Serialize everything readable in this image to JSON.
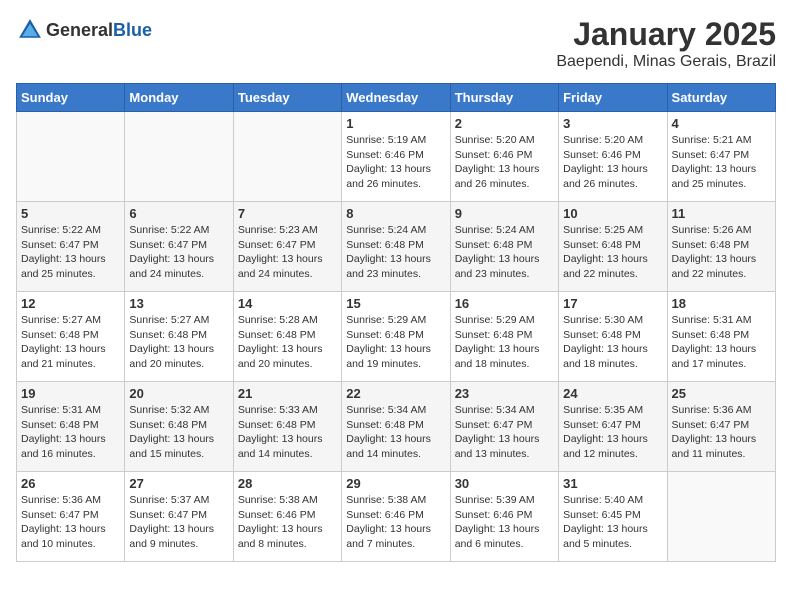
{
  "header": {
    "logo": {
      "general": "General",
      "blue": "Blue"
    },
    "title": "January 2025",
    "subtitle": "Baependi, Minas Gerais, Brazil"
  },
  "calendar": {
    "weekdays": [
      "Sunday",
      "Monday",
      "Tuesday",
      "Wednesday",
      "Thursday",
      "Friday",
      "Saturday"
    ],
    "rows": [
      [
        {
          "day": "",
          "sunrise": "",
          "sunset": "",
          "daylight": ""
        },
        {
          "day": "",
          "sunrise": "",
          "sunset": "",
          "daylight": ""
        },
        {
          "day": "",
          "sunrise": "",
          "sunset": "",
          "daylight": ""
        },
        {
          "day": "1",
          "sunrise": "Sunrise: 5:19 AM",
          "sunset": "Sunset: 6:46 PM",
          "daylight": "Daylight: 13 hours and 26 minutes."
        },
        {
          "day": "2",
          "sunrise": "Sunrise: 5:20 AM",
          "sunset": "Sunset: 6:46 PM",
          "daylight": "Daylight: 13 hours and 26 minutes."
        },
        {
          "day": "3",
          "sunrise": "Sunrise: 5:20 AM",
          "sunset": "Sunset: 6:46 PM",
          "daylight": "Daylight: 13 hours and 26 minutes."
        },
        {
          "day": "4",
          "sunrise": "Sunrise: 5:21 AM",
          "sunset": "Sunset: 6:47 PM",
          "daylight": "Daylight: 13 hours and 25 minutes."
        }
      ],
      [
        {
          "day": "5",
          "sunrise": "Sunrise: 5:22 AM",
          "sunset": "Sunset: 6:47 PM",
          "daylight": "Daylight: 13 hours and 25 minutes."
        },
        {
          "day": "6",
          "sunrise": "Sunrise: 5:22 AM",
          "sunset": "Sunset: 6:47 PM",
          "daylight": "Daylight: 13 hours and 24 minutes."
        },
        {
          "day": "7",
          "sunrise": "Sunrise: 5:23 AM",
          "sunset": "Sunset: 6:47 PM",
          "daylight": "Daylight: 13 hours and 24 minutes."
        },
        {
          "day": "8",
          "sunrise": "Sunrise: 5:24 AM",
          "sunset": "Sunset: 6:48 PM",
          "daylight": "Daylight: 13 hours and 23 minutes."
        },
        {
          "day": "9",
          "sunrise": "Sunrise: 5:24 AM",
          "sunset": "Sunset: 6:48 PM",
          "daylight": "Daylight: 13 hours and 23 minutes."
        },
        {
          "day": "10",
          "sunrise": "Sunrise: 5:25 AM",
          "sunset": "Sunset: 6:48 PM",
          "daylight": "Daylight: 13 hours and 22 minutes."
        },
        {
          "day": "11",
          "sunrise": "Sunrise: 5:26 AM",
          "sunset": "Sunset: 6:48 PM",
          "daylight": "Daylight: 13 hours and 22 minutes."
        }
      ],
      [
        {
          "day": "12",
          "sunrise": "Sunrise: 5:27 AM",
          "sunset": "Sunset: 6:48 PM",
          "daylight": "Daylight: 13 hours and 21 minutes."
        },
        {
          "day": "13",
          "sunrise": "Sunrise: 5:27 AM",
          "sunset": "Sunset: 6:48 PM",
          "daylight": "Daylight: 13 hours and 20 minutes."
        },
        {
          "day": "14",
          "sunrise": "Sunrise: 5:28 AM",
          "sunset": "Sunset: 6:48 PM",
          "daylight": "Daylight: 13 hours and 20 minutes."
        },
        {
          "day": "15",
          "sunrise": "Sunrise: 5:29 AM",
          "sunset": "Sunset: 6:48 PM",
          "daylight": "Daylight: 13 hours and 19 minutes."
        },
        {
          "day": "16",
          "sunrise": "Sunrise: 5:29 AM",
          "sunset": "Sunset: 6:48 PM",
          "daylight": "Daylight: 13 hours and 18 minutes."
        },
        {
          "day": "17",
          "sunrise": "Sunrise: 5:30 AM",
          "sunset": "Sunset: 6:48 PM",
          "daylight": "Daylight: 13 hours and 18 minutes."
        },
        {
          "day": "18",
          "sunrise": "Sunrise: 5:31 AM",
          "sunset": "Sunset: 6:48 PM",
          "daylight": "Daylight: 13 hours and 17 minutes."
        }
      ],
      [
        {
          "day": "19",
          "sunrise": "Sunrise: 5:31 AM",
          "sunset": "Sunset: 6:48 PM",
          "daylight": "Daylight: 13 hours and 16 minutes."
        },
        {
          "day": "20",
          "sunrise": "Sunrise: 5:32 AM",
          "sunset": "Sunset: 6:48 PM",
          "daylight": "Daylight: 13 hours and 15 minutes."
        },
        {
          "day": "21",
          "sunrise": "Sunrise: 5:33 AM",
          "sunset": "Sunset: 6:48 PM",
          "daylight": "Daylight: 13 hours and 14 minutes."
        },
        {
          "day": "22",
          "sunrise": "Sunrise: 5:34 AM",
          "sunset": "Sunset: 6:48 PM",
          "daylight": "Daylight: 13 hours and 14 minutes."
        },
        {
          "day": "23",
          "sunrise": "Sunrise: 5:34 AM",
          "sunset": "Sunset: 6:47 PM",
          "daylight": "Daylight: 13 hours and 13 minutes."
        },
        {
          "day": "24",
          "sunrise": "Sunrise: 5:35 AM",
          "sunset": "Sunset: 6:47 PM",
          "daylight": "Daylight: 13 hours and 12 minutes."
        },
        {
          "day": "25",
          "sunrise": "Sunrise: 5:36 AM",
          "sunset": "Sunset: 6:47 PM",
          "daylight": "Daylight: 13 hours and 11 minutes."
        }
      ],
      [
        {
          "day": "26",
          "sunrise": "Sunrise: 5:36 AM",
          "sunset": "Sunset: 6:47 PM",
          "daylight": "Daylight: 13 hours and 10 minutes."
        },
        {
          "day": "27",
          "sunrise": "Sunrise: 5:37 AM",
          "sunset": "Sunset: 6:47 PM",
          "daylight": "Daylight: 13 hours and 9 minutes."
        },
        {
          "day": "28",
          "sunrise": "Sunrise: 5:38 AM",
          "sunset": "Sunset: 6:46 PM",
          "daylight": "Daylight: 13 hours and 8 minutes."
        },
        {
          "day": "29",
          "sunrise": "Sunrise: 5:38 AM",
          "sunset": "Sunset: 6:46 PM",
          "daylight": "Daylight: 13 hours and 7 minutes."
        },
        {
          "day": "30",
          "sunrise": "Sunrise: 5:39 AM",
          "sunset": "Sunset: 6:46 PM",
          "daylight": "Daylight: 13 hours and 6 minutes."
        },
        {
          "day": "31",
          "sunrise": "Sunrise: 5:40 AM",
          "sunset": "Sunset: 6:45 PM",
          "daylight": "Daylight: 13 hours and 5 minutes."
        },
        {
          "day": "",
          "sunrise": "",
          "sunset": "",
          "daylight": ""
        }
      ]
    ]
  }
}
